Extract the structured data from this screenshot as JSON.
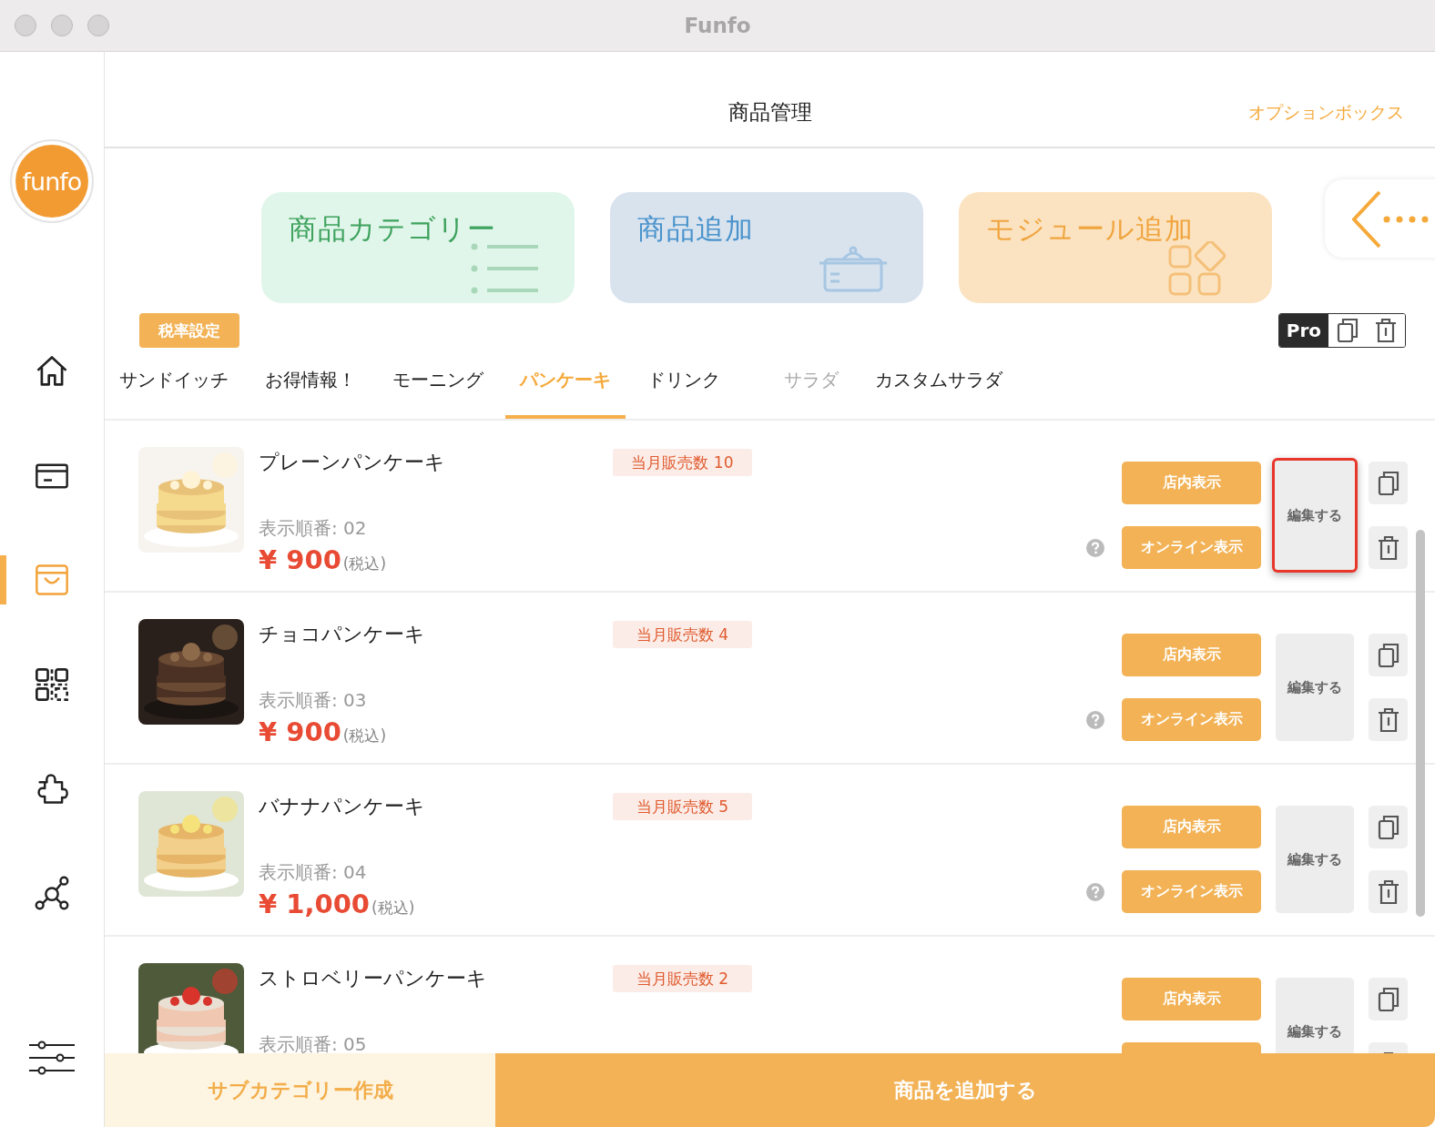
{
  "window": {
    "title": "Funfo"
  },
  "sidebar": {
    "logo": "funfo",
    "items": [
      {
        "kind": "home",
        "selected": false
      },
      {
        "kind": "card",
        "selected": false
      },
      {
        "kind": "basket",
        "selected": true
      },
      {
        "kind": "qr",
        "selected": false
      },
      {
        "kind": "puzzle",
        "selected": false
      },
      {
        "kind": "network",
        "selected": false
      }
    ],
    "bottom_item": {
      "kind": "sliders"
    }
  },
  "header": {
    "title": "商品管理",
    "action": "オプションボックス"
  },
  "shortcut_cards": [
    {
      "kind": "category",
      "label": "商品カテゴリー",
      "color": "#3fa35f"
    },
    {
      "kind": "product",
      "label": "商品追加",
      "color": "#4a93cc"
    },
    {
      "kind": "module",
      "label": "モジュール追加",
      "color": "#f0a540"
    }
  ],
  "tax_button": "税率設定",
  "pro_toolbar": {
    "label": "Pro"
  },
  "tabs": [
    {
      "label": "サンドイッチ",
      "selected": false,
      "disabled": false
    },
    {
      "label": "お得情報！",
      "selected": false,
      "disabled": false
    },
    {
      "label": "モーニング",
      "selected": false,
      "disabled": false
    },
    {
      "label": "パンケーキ",
      "selected": true,
      "disabled": false
    },
    {
      "label": "ドリンク",
      "selected": false,
      "disabled": false
    },
    {
      "label": "サラダ",
      "selected": false,
      "disabled": true
    },
    {
      "label": "カスタムサラダ",
      "selected": false,
      "disabled": false
    }
  ],
  "products": [
    {
      "name": "プレーンパンケーキ",
      "sales": "当月販売数 10",
      "order": "表示順番: 02",
      "price": "¥ 900",
      "tax_note": "(税込)",
      "in_store_label": "店内表示",
      "online_label": "オンライン表示",
      "edit_label": "編集する",
      "highlighted": true,
      "help": true
    },
    {
      "name": "チョコパンケーキ",
      "sales": "当月販売数 4",
      "order": "表示順番: 03",
      "price": "¥ 900",
      "tax_note": "(税込)",
      "in_store_label": "店内表示",
      "online_label": "オンライン表示",
      "edit_label": "編集する",
      "highlighted": false,
      "help": true
    },
    {
      "name": "バナナパンケーキ",
      "sales": "当月販売数 5",
      "order": "表示順番: 04",
      "price": "¥ 1,000",
      "tax_note": "(税込)",
      "in_store_label": "店内表示",
      "online_label": "オンライン表示",
      "edit_label": "編集する",
      "highlighted": false,
      "help": true
    },
    {
      "name": "ストロベリーパンケーキ",
      "sales": "当月販売数 2",
      "order": "表示順番: 05",
      "in_store_label": "店内表示",
      "edit_label": "編集する",
      "highlighted": false
    }
  ],
  "footer": {
    "secondary": "サブカテゴリー作成",
    "primary": "商品を追加する"
  }
}
